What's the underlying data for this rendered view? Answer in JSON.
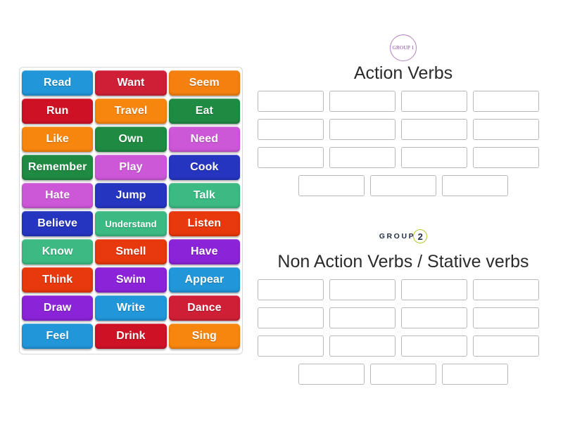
{
  "tile_bank": {
    "name": "word-tile-bank",
    "tiles": [
      {
        "label": "Read",
        "color": "#2196d8"
      },
      {
        "label": "Want",
        "color": "#cf1f36"
      },
      {
        "label": "Seem",
        "color": "#f48010"
      },
      {
        "label": "Run",
        "color": "#cf1126"
      },
      {
        "label": "Travel",
        "color": "#f7860e"
      },
      {
        "label": "Eat",
        "color": "#1f8a42"
      },
      {
        "label": "Like",
        "color": "#f7860e"
      },
      {
        "label": "Own",
        "color": "#1f8a42"
      },
      {
        "label": "Need",
        "color": "#cc58d8"
      },
      {
        "label": "Remember",
        "color": "#1f8a42"
      },
      {
        "label": "Play",
        "color": "#cc58d8"
      },
      {
        "label": "Cook",
        "color": "#2535c0"
      },
      {
        "label": "Hate",
        "color": "#cc58d8"
      },
      {
        "label": "Jump",
        "color": "#2535c0"
      },
      {
        "label": "Talk",
        "color": "#3cba84"
      },
      {
        "label": "Believe",
        "color": "#2535c0"
      },
      {
        "label": "Understand",
        "color": "#3cba84"
      },
      {
        "label": "Listen",
        "color": "#e8380d"
      },
      {
        "label": "Know",
        "color": "#3cba84"
      },
      {
        "label": "Smell",
        "color": "#e8380d"
      },
      {
        "label": "Have",
        "color": "#8b23d8"
      },
      {
        "label": "Think",
        "color": "#e8380d"
      },
      {
        "label": "Swim",
        "color": "#8b23d8"
      },
      {
        "label": "Appear",
        "color": "#2196d8"
      },
      {
        "label": "Draw",
        "color": "#8b23d8"
      },
      {
        "label": "Write",
        "color": "#2196d8"
      },
      {
        "label": "Dance",
        "color": "#cf1f36"
      },
      {
        "label": "Feel",
        "color": "#2196d8"
      },
      {
        "label": "Drink",
        "color": "#cf1126"
      },
      {
        "label": "Sing",
        "color": "#f7860e"
      }
    ]
  },
  "groups": [
    {
      "id": "group-1",
      "badge_style": "circle",
      "badge_text": "GROUP 1",
      "badge_word": "GROUP",
      "badge_number": "1",
      "badge_color": "#8e3f9e",
      "title": "Action Verbs",
      "dropzone_rows": [
        4,
        4,
        4,
        3
      ],
      "dropzone_values": [
        "",
        "",
        "",
        "",
        "",
        "",
        "",
        "",
        "",
        "",
        "",
        "",
        "",
        "",
        ""
      ]
    },
    {
      "id": "group-2",
      "badge_style": "inline",
      "badge_text": "GROUP 2",
      "badge_word": "GROUP",
      "badge_number": "2",
      "badge_color": "#233044",
      "badge_accent_color": "#b5c63a",
      "title": "Non Action Verbs / Stative verbs",
      "dropzone_rows": [
        4,
        4,
        4,
        3
      ],
      "dropzone_values": [
        "",
        "",
        "",
        "",
        "",
        "",
        "",
        "",
        "",
        "",
        "",
        "",
        "",
        "",
        ""
      ]
    }
  ]
}
